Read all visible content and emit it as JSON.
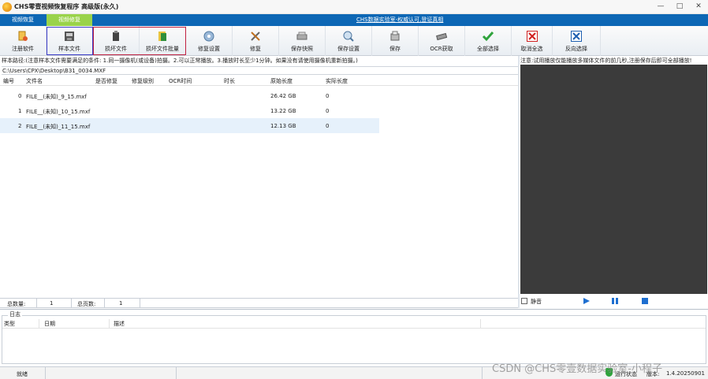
{
  "window": {
    "title": "CHS零壹视频恢复程序 高级版(永久)",
    "minimize": "—",
    "maximize": "□",
    "close": "✕"
  },
  "tabs": [
    {
      "label": "视频恢复"
    },
    {
      "label": "视频修复"
    }
  ],
  "promo_link": "CHS数据实验室-权威认可,登证真相",
  "toolbar": [
    {
      "label": "注册软件",
      "icon": "register-icon"
    },
    {
      "label": "样本文件",
      "icon": "sample-file-icon"
    },
    {
      "label": "损坏文件",
      "icon": "damaged-file-icon"
    },
    {
      "label": "损坏文件批量",
      "icon": "damaged-batch-icon"
    },
    {
      "label": "修复设置",
      "icon": "repair-settings-icon"
    },
    {
      "label": "修复",
      "icon": "repair-icon"
    },
    {
      "label": "保存快照",
      "icon": "save-snapshot-icon"
    },
    {
      "label": "保存设置",
      "icon": "save-settings-icon"
    },
    {
      "label": "保存",
      "icon": "save-icon"
    },
    {
      "label": "OCR获取",
      "icon": "ocr-icon"
    },
    {
      "label": "全部选择",
      "icon": "select-all-icon"
    },
    {
      "label": "取消全选",
      "icon": "deselect-all-icon"
    },
    {
      "label": "反向选择",
      "icon": "invert-select-icon"
    }
  ],
  "hint": "样本路径:(注意样本文件需要满足的条件: 1.同一摄像机(或设备)拍摄。2.可以正常播放。3.播放时长至少1分钟。如果没有请使用摄像机重新拍摄。)",
  "sample_path": "C:\\Users\\CPX\\Desktop\\B31_0034.MXF",
  "table": {
    "headers": [
      "编号",
      "文件名",
      "是否修复",
      "修复级别",
      "OCR时间",
      "时长",
      "原始长度",
      "实际长度"
    ],
    "rows": [
      {
        "id": "0",
        "name": "FILE__(未知)_9_15.mxf",
        "orig": "26.42 GB",
        "actual": "0"
      },
      {
        "id": "1",
        "name": "FILE__(未知)_10_15.mxf",
        "orig": "13.22 GB",
        "actual": "0"
      },
      {
        "id": "2",
        "name": "FILE__(未知)_11_15.mxf",
        "orig": "12.13 GB",
        "actual": "0"
      }
    ]
  },
  "summary": {
    "total_label": "总数量:",
    "total_value": "1",
    "pages_label": "总页数:",
    "pages_value": "1"
  },
  "preview": {
    "note": "注意:试用播放仅能播放多媒体文件的前几秒,注册保存后即可全部播放!",
    "mute_label": "静音"
  },
  "log": {
    "title": "日志",
    "headers": [
      "类型",
      "日期",
      "描述"
    ]
  },
  "status": {
    "ready": "就绪",
    "service": "运行状态",
    "version_label": "版本:",
    "version": "1.4.20250901"
  },
  "watermark": "CSDN @CHS零壹数据实验室-小程子",
  "colors": {
    "tab_bar": "#0d67b5",
    "tab_active": "#9ad34a",
    "preview_bg": "#3b3b3b",
    "selection_row": "#e6f1fb",
    "accent_blue": "#1e6fd0"
  }
}
